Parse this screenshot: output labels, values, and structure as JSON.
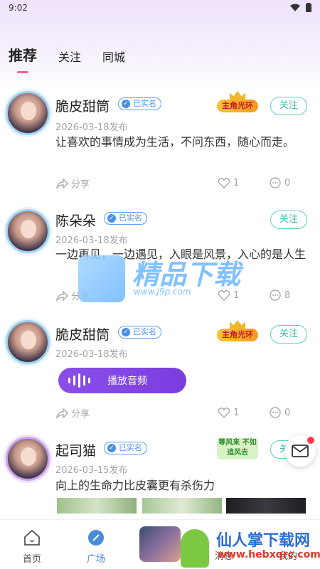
{
  "status_bar": {
    "time": "9:02"
  },
  "tabs": [
    {
      "label": "推荐",
      "active": true
    },
    {
      "label": "关注",
      "active": false
    },
    {
      "label": "同城",
      "active": false
    }
  ],
  "posts": [
    {
      "name": "脆皮甜筒",
      "badge": "已实名",
      "medal": "主角光环",
      "follow": "关注",
      "date": "2026-03-18发布",
      "content": "让喜欢的事情成为生活，不问东西，随心而走。",
      "share": "分享",
      "likes": "1",
      "comments": "0"
    },
    {
      "name": "陈朵朵",
      "badge": "已实名",
      "follow": "关注",
      "date": "2026-03-18发布",
      "content": "一边再见，一边遇见，入眼是风景，入心的是人生",
      "share": "分享",
      "likes": "1",
      "comments": "8"
    },
    {
      "name": "脆皮甜筒",
      "badge": "已实名",
      "medal": "主角光环",
      "follow": "关注",
      "date": "2026-03-18发布",
      "audio_label": "播放音频",
      "share": "分享",
      "likes": "1",
      "comments": "0"
    },
    {
      "name": "起司猫",
      "badge": "已实名",
      "medal": "等风来 不如追风去",
      "follow": "关注",
      "date": "2026-03-15发布",
      "content": "向上的生命力比皮囊更有杀伤力"
    }
  ],
  "watermark": {
    "title": "精品下载",
    "url": "www.j9p.com"
  },
  "bottom_nav": [
    {
      "label": "首页",
      "active": false
    },
    {
      "label": "广场",
      "active": true
    },
    {
      "label": "消息",
      "active": false
    },
    {
      "label": "我的",
      "active": false
    }
  ],
  "site_mark": {
    "cn": "仙人掌下载网",
    "en": "www.hebxqrc.com"
  },
  "colors": {
    "accent_pink": "#ff5fa2",
    "follow_teal": "#3fb8ac",
    "audio_purple": "#8b4fe8",
    "nav_active": "#4a8bd8"
  }
}
